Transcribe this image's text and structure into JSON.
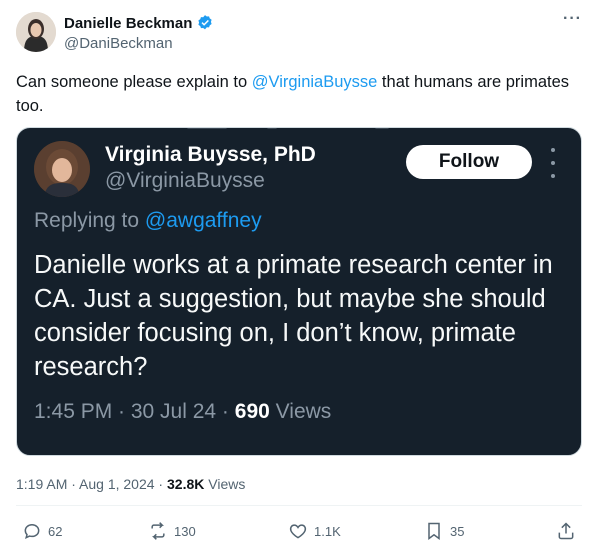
{
  "author": {
    "display_name": "Danielle Beckman",
    "handle": "@DaniBeckman"
  },
  "tweet": {
    "text_before": "Can someone please explain to ",
    "mention": "@VirginiaBuysse",
    "text_after": " that humans are primates too."
  },
  "embedded": {
    "display_name": "Virginia Buysse, PhD",
    "handle": "@VirginiaBuysse",
    "follow_label": "Follow",
    "replying_prefix": "Replying to ",
    "replying_to": "@awgaffney",
    "body": "Danielle works at a primate research center in CA. Just a suggestion, but maybe she should consider focusing on, I don’t know, primate research?",
    "time": "1:45 PM · 30 Jul 24 · ",
    "views_count": "690",
    "views_label": " Views"
  },
  "meta": {
    "timestamp": "1:19 AM · Aug 1, 2024 · ",
    "views_count": "32.8K",
    "views_label": " Views"
  },
  "actions": {
    "replies": "62",
    "reposts": "130",
    "likes": "1.1K",
    "bookmarks": "35"
  },
  "colors": {
    "accent": "#1d9bf0",
    "embed_bg": "#15202b"
  }
}
